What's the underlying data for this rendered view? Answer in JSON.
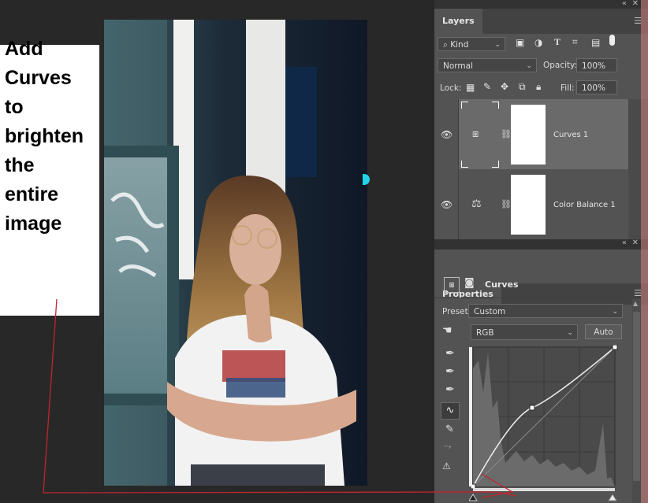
{
  "annotation": {
    "lines": [
      "Add",
      "Curves",
      "to",
      "brighten",
      "the",
      "entire",
      "image"
    ]
  },
  "layers_panel": {
    "tab": "Layers",
    "filter": {
      "value": "Kind"
    },
    "blend_mode": {
      "value": "Normal"
    },
    "opacity": {
      "label": "Opacity:",
      "value": "100%"
    },
    "lock": {
      "label": "Lock:"
    },
    "fill": {
      "label": "Fill:",
      "value": "100%"
    },
    "layers": [
      {
        "name": "Curves 1",
        "icon": "curves-adjustment-icon",
        "selected": true
      },
      {
        "name": "Color Balance 1",
        "icon": "balance-scale-icon",
        "selected": false
      }
    ]
  },
  "properties_panel": {
    "tab": "Properties",
    "title": "Curves",
    "preset": {
      "label": "Preset:",
      "value": "Custom"
    },
    "channel": {
      "value": "RGB"
    },
    "auto_button": "Auto"
  },
  "colors": {
    "panel_bg": "#535353",
    "dark_bg": "#282828",
    "accent_cyan": "#22d3ea",
    "annotation_red": "#c0262c"
  }
}
